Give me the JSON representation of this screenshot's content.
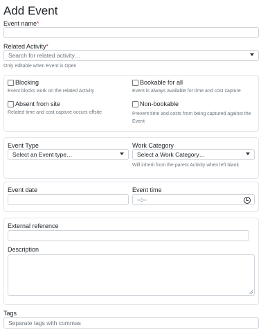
{
  "page": {
    "title": "Add Event"
  },
  "event_name": {
    "label": "Event name",
    "required_mark": "*",
    "value": ""
  },
  "related_activity": {
    "label": "Related Activity",
    "required_mark": "*",
    "placeholder": "Search for related activity…",
    "help": "Only editable when Event is Open"
  },
  "flags": {
    "blocking": {
      "label": "Blocking",
      "help": "Event blocks work on the related Activity",
      "checked": false
    },
    "bookable_for_all": {
      "label": "Bookable for all",
      "help": "Event is always available for time and cost capture",
      "checked": false
    },
    "absent_from_site": {
      "label": "Absent from site",
      "help": "Related time and cost capture occurs offsite",
      "checked": false
    },
    "non_bookable": {
      "label": "Non-bookable",
      "help": "Prevent time and costs from being captured against the Event",
      "checked": false
    }
  },
  "event_type": {
    "label": "Event Type",
    "selected": "Select an Event type…"
  },
  "work_category": {
    "label": "Work Category",
    "selected": "Select a Work Category…",
    "help": "Will inherit from the parent Activity when left blank"
  },
  "event_date": {
    "label": "Event date",
    "value": ""
  },
  "event_time": {
    "label": "Event time",
    "value": "--:--"
  },
  "external_reference": {
    "label": "External reference",
    "value": ""
  },
  "description": {
    "label": "Description",
    "value": ""
  },
  "tags": {
    "label": "Tags",
    "placeholder": "Separate tags with commas"
  },
  "icons": {
    "time_picker": "clock-icon",
    "select_caret": "chevron-down-icon"
  }
}
